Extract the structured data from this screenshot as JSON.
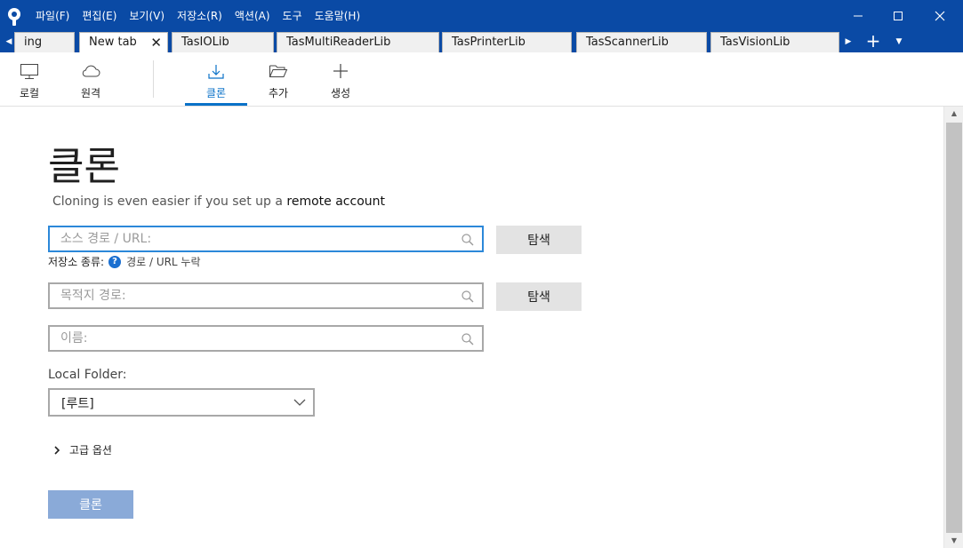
{
  "menu": [
    "파일(F)",
    "편집(E)",
    "보기(V)",
    "저장소(R)",
    "액션(A)",
    "도구",
    "도움말(H)"
  ],
  "tabs": [
    {
      "label": "ing"
    },
    {
      "label": "New tab"
    },
    {
      "label": "TasIOLib"
    },
    {
      "label": "TasMultiReaderLib"
    },
    {
      "label": "TasPrinterLib"
    },
    {
      "label": "TasScannerLib"
    },
    {
      "label": "TasVisionLib"
    }
  ],
  "toolbar": {
    "local": "로컬",
    "remote": "원격",
    "clone": "클론",
    "add": "추가",
    "create": "생성"
  },
  "main": {
    "heading": "클론",
    "subtitle_prefix": "Cloning is even easier if you set up a ",
    "subtitle_link": "remote account",
    "source_placeholder": "소스 경로 / URL:",
    "browse_label": "탐색",
    "repo_type_label": "저장소 종류:",
    "repo_type_help": "?",
    "repo_type_status": "경로 / URL 누락",
    "dest_placeholder": "목적지 경로:",
    "name_placeholder": "이름:",
    "local_folder_label": "Local Folder:",
    "local_folder_value": "[루트]",
    "advanced_label": "고급 옵션",
    "clone_button": "클론"
  },
  "colors": {
    "titlebar": "#0a4aa5",
    "accent": "#0a72c8",
    "clone_button": "#8aaad8"
  }
}
